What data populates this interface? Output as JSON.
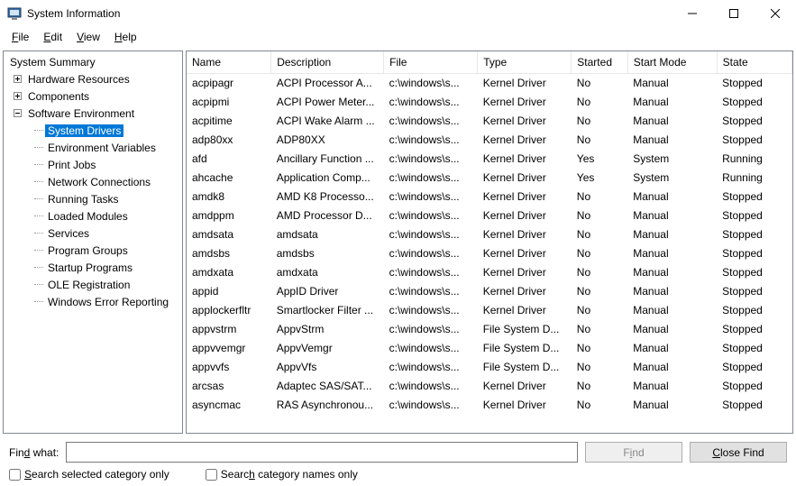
{
  "window": {
    "title": "System Information"
  },
  "menu": {
    "file": "File",
    "edit": "Edit",
    "view": "View",
    "help": "Help"
  },
  "tree": {
    "root": "System Summary",
    "nodes": [
      {
        "label": "Hardware Resources",
        "expandable": true,
        "expanded": false
      },
      {
        "label": "Components",
        "expandable": true,
        "expanded": false
      },
      {
        "label": "Software Environment",
        "expandable": true,
        "expanded": true,
        "children": [
          {
            "label": "System Drivers",
            "selected": true
          },
          {
            "label": "Environment Variables"
          },
          {
            "label": "Print Jobs"
          },
          {
            "label": "Network Connections"
          },
          {
            "label": "Running Tasks"
          },
          {
            "label": "Loaded Modules"
          },
          {
            "label": "Services"
          },
          {
            "label": "Program Groups"
          },
          {
            "label": "Startup Programs"
          },
          {
            "label": "OLE Registration"
          },
          {
            "label": "Windows Error Reporting"
          }
        ]
      }
    ]
  },
  "grid": {
    "headers": {
      "name": "Name",
      "description": "Description",
      "file": "File",
      "type": "Type",
      "started": "Started",
      "start_mode": "Start Mode",
      "state": "State"
    },
    "rows": [
      {
        "name": "acpipagr",
        "description": "ACPI Processor A...",
        "file": "c:\\windows\\s...",
        "type": "Kernel Driver",
        "started": "No",
        "start_mode": "Manual",
        "state": "Stopped"
      },
      {
        "name": "acpipmi",
        "description": "ACPI Power Meter...",
        "file": "c:\\windows\\s...",
        "type": "Kernel Driver",
        "started": "No",
        "start_mode": "Manual",
        "state": "Stopped"
      },
      {
        "name": "acpitime",
        "description": "ACPI Wake Alarm ...",
        "file": "c:\\windows\\s...",
        "type": "Kernel Driver",
        "started": "No",
        "start_mode": "Manual",
        "state": "Stopped"
      },
      {
        "name": "adp80xx",
        "description": "ADP80XX",
        "file": "c:\\windows\\s...",
        "type": "Kernel Driver",
        "started": "No",
        "start_mode": "Manual",
        "state": "Stopped"
      },
      {
        "name": "afd",
        "description": "Ancillary Function ...",
        "file": "c:\\windows\\s...",
        "type": "Kernel Driver",
        "started": "Yes",
        "start_mode": "System",
        "state": "Running"
      },
      {
        "name": "ahcache",
        "description": "Application Comp...",
        "file": "c:\\windows\\s...",
        "type": "Kernel Driver",
        "started": "Yes",
        "start_mode": "System",
        "state": "Running"
      },
      {
        "name": "amdk8",
        "description": "AMD K8 Processo...",
        "file": "c:\\windows\\s...",
        "type": "Kernel Driver",
        "started": "No",
        "start_mode": "Manual",
        "state": "Stopped"
      },
      {
        "name": "amdppm",
        "description": "AMD Processor D...",
        "file": "c:\\windows\\s...",
        "type": "Kernel Driver",
        "started": "No",
        "start_mode": "Manual",
        "state": "Stopped"
      },
      {
        "name": "amdsata",
        "description": "amdsata",
        "file": "c:\\windows\\s...",
        "type": "Kernel Driver",
        "started": "No",
        "start_mode": "Manual",
        "state": "Stopped"
      },
      {
        "name": "amdsbs",
        "description": "amdsbs",
        "file": "c:\\windows\\s...",
        "type": "Kernel Driver",
        "started": "No",
        "start_mode": "Manual",
        "state": "Stopped"
      },
      {
        "name": "amdxata",
        "description": "amdxata",
        "file": "c:\\windows\\s...",
        "type": "Kernel Driver",
        "started": "No",
        "start_mode": "Manual",
        "state": "Stopped"
      },
      {
        "name": "appid",
        "description": "AppID Driver",
        "file": "c:\\windows\\s...",
        "type": "Kernel Driver",
        "started": "No",
        "start_mode": "Manual",
        "state": "Stopped"
      },
      {
        "name": "applockerfltr",
        "description": "Smartlocker Filter ...",
        "file": "c:\\windows\\s...",
        "type": "Kernel Driver",
        "started": "No",
        "start_mode": "Manual",
        "state": "Stopped"
      },
      {
        "name": "appvstrm",
        "description": "AppvStrm",
        "file": "c:\\windows\\s...",
        "type": "File System D...",
        "started": "No",
        "start_mode": "Manual",
        "state": "Stopped"
      },
      {
        "name": "appvvemgr",
        "description": "AppvVemgr",
        "file": "c:\\windows\\s...",
        "type": "File System D...",
        "started": "No",
        "start_mode": "Manual",
        "state": "Stopped"
      },
      {
        "name": "appvvfs",
        "description": "AppvVfs",
        "file": "c:\\windows\\s...",
        "type": "File System D...",
        "started": "No",
        "start_mode": "Manual",
        "state": "Stopped"
      },
      {
        "name": "arcsas",
        "description": "Adaptec SAS/SAT...",
        "file": "c:\\windows\\s...",
        "type": "Kernel Driver",
        "started": "No",
        "start_mode": "Manual",
        "state": "Stopped"
      },
      {
        "name": "asyncmac",
        "description": "RAS Asynchronou...",
        "file": "c:\\windows\\s...",
        "type": "Kernel Driver",
        "started": "No",
        "start_mode": "Manual",
        "state": "Stopped"
      }
    ]
  },
  "find": {
    "label_prefix": "Fin",
    "label_ul": "d",
    "label_suffix": " what:",
    "value": "",
    "find_btn_prefix": "F",
    "find_btn_ul": "i",
    "find_btn_suffix": "nd",
    "close_btn_ul": "C",
    "close_btn_suffix": "lose Find",
    "chk1_ul": "S",
    "chk1_suffix": "earch selected category only",
    "chk2_prefix": "Searc",
    "chk2_ul": "h",
    "chk2_suffix": " category names only"
  }
}
